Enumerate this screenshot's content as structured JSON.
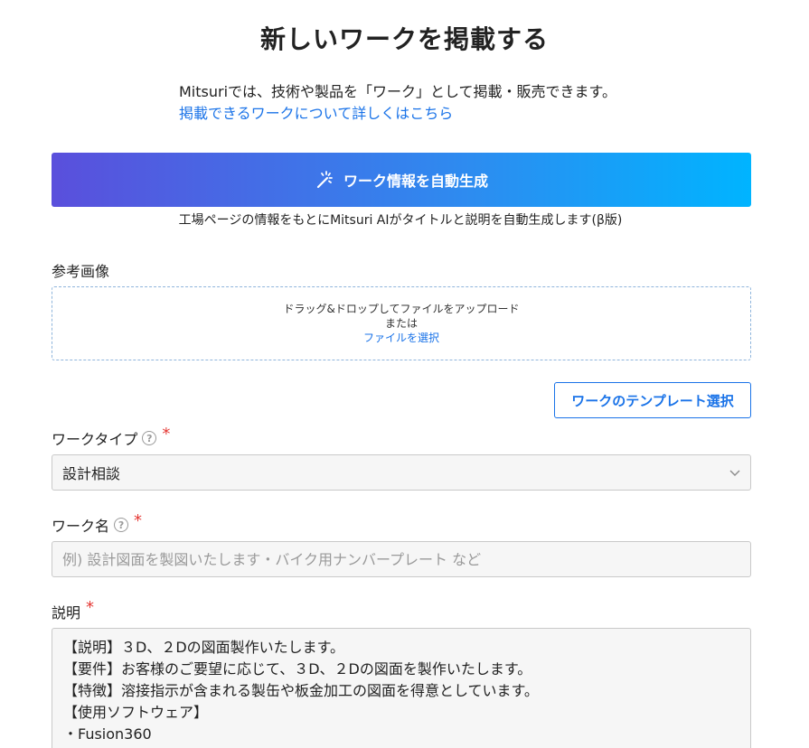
{
  "page_title": "新しいワークを掲載する",
  "intro": {
    "text": "Mitsuriでは、技術や製品を「ワーク」として掲載・販売できます。",
    "link": "掲載できるワークについて詳しくはこちら"
  },
  "ai_generate": {
    "button_label": "ワーク情報を自動生成",
    "icon": "magic-wand-icon",
    "note": "工場ページの情報をもとにMitsuri AIがタイトルと説明を自動生成します(β版)"
  },
  "reference_image": {
    "label": "参考画像",
    "drop_text": "ドラッグ&ドロップしてファイルをアップロード",
    "or_text": "または",
    "select_link": "ファイルを選択"
  },
  "template_button": "ワークのテンプレート選択",
  "work_type": {
    "label": "ワークタイプ",
    "help_icon": "?",
    "required_mark": "*",
    "value": "設計相談"
  },
  "work_name": {
    "label": "ワーク名",
    "help_icon": "?",
    "required_mark": "*",
    "placeholder": "例) 設計図面を製図いたします・バイク用ナンバープレート など",
    "value": ""
  },
  "description": {
    "label": "説明",
    "required_mark": "*",
    "lines": [
      "【説明】３D、２Dの図面製作いたします。",
      "【要件】お客様のご要望に応じて、３D、２Dの図面を製作いたします。",
      "【特徴】溶接指示が含まれる製缶や板金加工の図面を得意としています。",
      "【使用ソフトウェア】",
      "・Fusion360"
    ]
  },
  "colors": {
    "link": "#1a73e8",
    "required": "#e53935",
    "gradient_start": "#5a4fdc",
    "gradient_end": "#00b4ff"
  }
}
